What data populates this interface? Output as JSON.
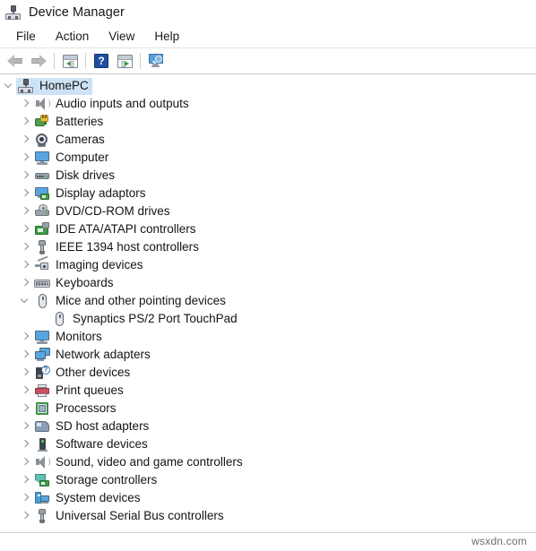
{
  "window": {
    "title": "Device Manager",
    "title_icon": "device-manager-icon"
  },
  "menubar": {
    "items": [
      {
        "label": "File"
      },
      {
        "label": "Action"
      },
      {
        "label": "View"
      },
      {
        "label": "Help"
      }
    ]
  },
  "toolbar": {
    "buttons": [
      {
        "name": "back-button",
        "icon": "back-arrow-icon"
      },
      {
        "name": "forward-button",
        "icon": "forward-arrow-icon"
      },
      {
        "name": "show-hide-console-tree-button",
        "icon": "console-tree-icon"
      },
      {
        "name": "help-button",
        "icon": "question-mark-icon"
      },
      {
        "name": "properties-button",
        "icon": "properties-window-icon"
      },
      {
        "name": "scan-for-hardware-changes-button",
        "icon": "scan-monitor-icon"
      }
    ]
  },
  "tree": {
    "root": {
      "label": "HomePC",
      "icon": "computer-node-icon",
      "expanded": true,
      "selected": true
    },
    "items": [
      {
        "label": "Audio inputs and outputs",
        "icon": "speaker-icon",
        "expanded": false
      },
      {
        "label": "Batteries",
        "icon": "battery-icon",
        "expanded": false
      },
      {
        "label": "Cameras",
        "icon": "camera-icon",
        "expanded": false
      },
      {
        "label": "Computer",
        "icon": "monitor-icon",
        "expanded": false
      },
      {
        "label": "Disk drives",
        "icon": "disk-drive-icon",
        "expanded": false
      },
      {
        "label": "Display adaptors",
        "icon": "display-adapter-icon",
        "expanded": false
      },
      {
        "label": "DVD/CD-ROM drives",
        "icon": "dvd-drive-icon",
        "expanded": false
      },
      {
        "label": "IDE ATA/ATAPI controllers",
        "icon": "ide-controller-icon",
        "expanded": false
      },
      {
        "label": "IEEE 1394 host controllers",
        "icon": "firewire-plug-icon",
        "expanded": false
      },
      {
        "label": "Imaging devices",
        "icon": "imaging-device-icon",
        "expanded": false
      },
      {
        "label": "Keyboards",
        "icon": "keyboard-icon",
        "expanded": false
      },
      {
        "label": "Mice and other pointing devices",
        "icon": "mouse-icon",
        "expanded": true,
        "children": [
          {
            "label": "Synaptics PS/2 Port TouchPad",
            "icon": "mouse-icon"
          }
        ]
      },
      {
        "label": "Monitors",
        "icon": "monitor-icon",
        "expanded": false
      },
      {
        "label": "Network adapters",
        "icon": "network-adapter-icon",
        "expanded": false
      },
      {
        "label": "Other devices",
        "icon": "unknown-device-icon",
        "expanded": false
      },
      {
        "label": "Print queues",
        "icon": "printer-icon",
        "expanded": false
      },
      {
        "label": "Processors",
        "icon": "processor-icon",
        "expanded": false
      },
      {
        "label": "SD host adapters",
        "icon": "sd-card-icon",
        "expanded": false
      },
      {
        "label": "Software devices",
        "icon": "software-device-icon",
        "expanded": false
      },
      {
        "label": "Sound, video and game controllers",
        "icon": "speaker-icon",
        "expanded": false
      },
      {
        "label": "Storage controllers",
        "icon": "storage-controller-icon",
        "expanded": false
      },
      {
        "label": "System devices",
        "icon": "system-device-icon",
        "expanded": false
      },
      {
        "label": "Universal Serial Bus controllers",
        "icon": "usb-plug-icon",
        "expanded": false
      }
    ]
  },
  "watermark": {
    "text": "wsxdn.com"
  },
  "colors": {
    "selection": "#cde3f5",
    "text": "#141414",
    "chevron": "#8a8a8a",
    "accent_blue": "#1f4e9c"
  }
}
